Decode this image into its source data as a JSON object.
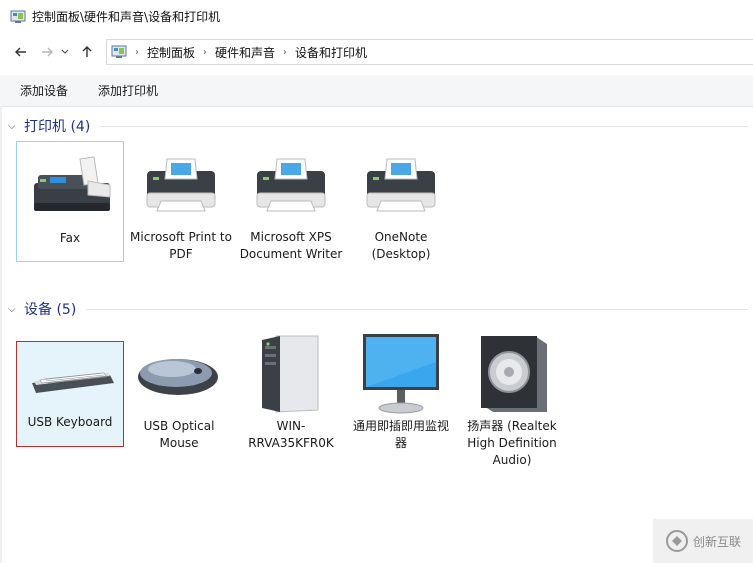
{
  "window": {
    "title": "控制面板\\硬件和声音\\设备和打印机"
  },
  "breadcrumb": [
    "控制面板",
    "硬件和声音",
    "设备和打印机"
  ],
  "toolbar": {
    "add_device": "添加设备",
    "add_printer": "添加打印机"
  },
  "groups": {
    "printers": {
      "title": "打印机 (4)"
    },
    "devices": {
      "title": "设备 (5)"
    }
  },
  "printers": [
    {
      "label": "Fax",
      "icon": "fax-icon"
    },
    {
      "label": "Microsoft Print to PDF",
      "icon": "printer-icon"
    },
    {
      "label": "Microsoft XPS Document Writer",
      "icon": "printer-icon"
    },
    {
      "label": "OneNote (Desktop)",
      "icon": "printer-icon"
    }
  ],
  "devices": [
    {
      "label": "USB Keyboard",
      "icon": "keyboard-icon"
    },
    {
      "label": "USB Optical Mouse",
      "icon": "mouse-icon"
    },
    {
      "label": "WIN-RRVA35KFR0K",
      "icon": "computer-tower-icon"
    },
    {
      "label": "通用即插即用监视器",
      "icon": "monitor-icon"
    },
    {
      "label": "扬声器 (Realtek High Definition Audio)",
      "icon": "speaker-icon"
    }
  ],
  "watermark": {
    "text": "创新互联"
  }
}
